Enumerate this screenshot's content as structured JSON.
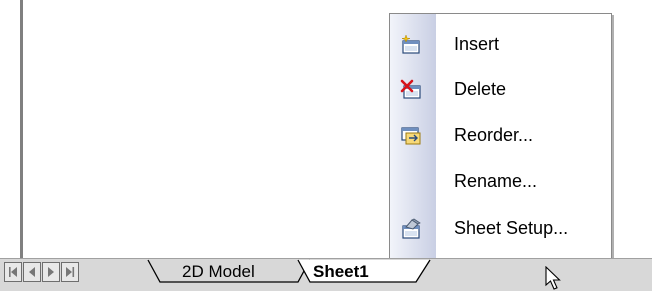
{
  "context_menu": {
    "items": [
      {
        "label": "Insert",
        "icon": "insert-sheet-icon"
      },
      {
        "label": "Delete",
        "icon": "delete-sheet-icon"
      },
      {
        "label": "Reorder...",
        "icon": "reorder-sheet-icon"
      },
      {
        "label": "Rename...",
        "icon": ""
      },
      {
        "label": "Sheet Setup...",
        "icon": "sheet-setup-icon"
      }
    ]
  },
  "sheet_tabs": {
    "navigation": [
      "first-sheet-icon",
      "previous-sheet-icon",
      "next-sheet-icon",
      "last-sheet-icon"
    ],
    "tabs": [
      {
        "label": "2D Model",
        "active": false
      },
      {
        "label": "Sheet1",
        "active": true
      }
    ]
  },
  "colors": {
    "menu_strip_start": "#f2f4fa",
    "menu_strip_end": "#c9cfe4",
    "tabbar_bg": "#d8d8d8"
  }
}
